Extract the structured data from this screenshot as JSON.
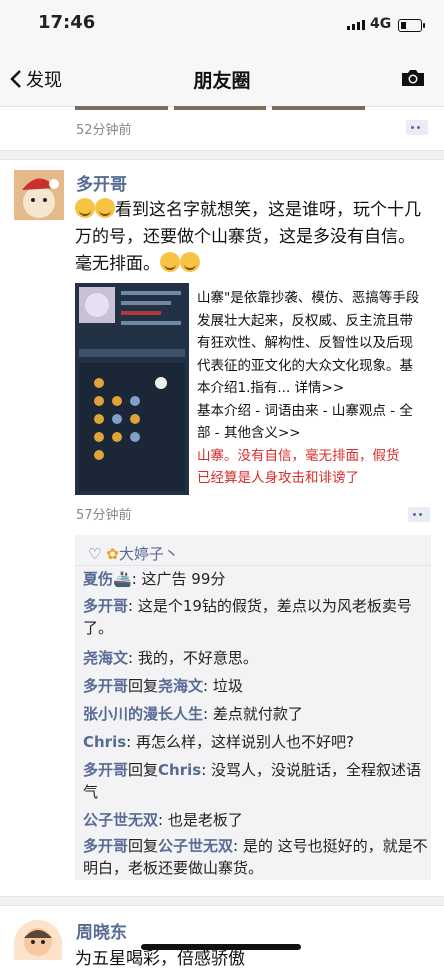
{
  "status": {
    "time": "17:46",
    "network": "4G"
  },
  "nav": {
    "back_label": "发现",
    "title": "朋友圈"
  },
  "prev_post": {
    "time": "52分钟前"
  },
  "post": {
    "author": "多开哥",
    "text": "看到这名字就想笑，这是谁呀，玩个十几万的号，还要做个山寨货，这是多没有自信。毫无排面。",
    "article_lines": [
      "山寨\"是依靠抄袭、模仿、恶搞等手段",
      "发展壮大起来，反权威、反主流且带",
      "有狂欢性、解构性、反智性以及后现",
      "代表征的亚文化的大众文化现象。基",
      "本介绍1.指有... 详情>>",
      "基本介绍 - 词语由来 - 山寨观点 - 全",
      "部 - 其他含义>>"
    ],
    "article_red_lines": [
      "山寨。没有自信，毫无排面，假货",
      "已经算是人身攻击和诽谤了"
    ],
    "time": "57分钟前",
    "likes": "大婷子丶",
    "comments": [
      {
        "name": "夏伤",
        "text": ": 这广告 99分"
      },
      {
        "name": "多开哥",
        "text": ": 这是个19钻的假货，差点以为风老板卖号了。"
      },
      {
        "name": "尧海文",
        "text": ": 我的，不好意思。"
      },
      {
        "name": "多开哥",
        "reply": "回复",
        "target": "尧海文",
        "text": ": 垃圾"
      },
      {
        "name": "张小川的漫长人生",
        "text": ": 差点就付款了"
      },
      {
        "name": "Chris",
        "text": ": 再怎么样，这样说别人也不好吧?"
      },
      {
        "name": "多开哥",
        "reply": "回复",
        "target": "Chris",
        "text": ": 没骂人，没说脏话，全程叙述语气"
      },
      {
        "name": "公子世无双",
        "text": ": 也是老板了"
      },
      {
        "name": "多开哥",
        "reply": "回复",
        "target": "公子世无双",
        "text": ": 是的 这号也挺好的，就是不明白，老板还要做山寨货。"
      }
    ]
  },
  "next_post": {
    "author": "周晓东",
    "text": "为五星喝彩，倍感骄傲"
  }
}
